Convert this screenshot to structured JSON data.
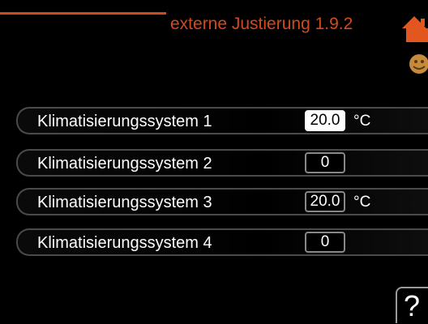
{
  "header": {
    "title": "externe Justierung 1.9.2",
    "accent_color": "#d24a1c",
    "home_icon": "home-icon",
    "smiley_icon": "smiley-icon"
  },
  "rows": [
    {
      "label": "Klimatisierungssystem 1",
      "value": "20.0",
      "unit": "°C",
      "selected": true
    },
    {
      "label": "Klimatisierungssystem 2",
      "value": "0",
      "unit": "",
      "selected": false
    },
    {
      "label": "Klimatisierungssystem 3",
      "value": "20.0",
      "unit": "°C",
      "selected": false
    },
    {
      "label": "Klimatisierungssystem 4",
      "value": "0",
      "unit": "",
      "selected": false
    }
  ],
  "help": {
    "label": "?",
    "icon": "question-mark-icon"
  }
}
